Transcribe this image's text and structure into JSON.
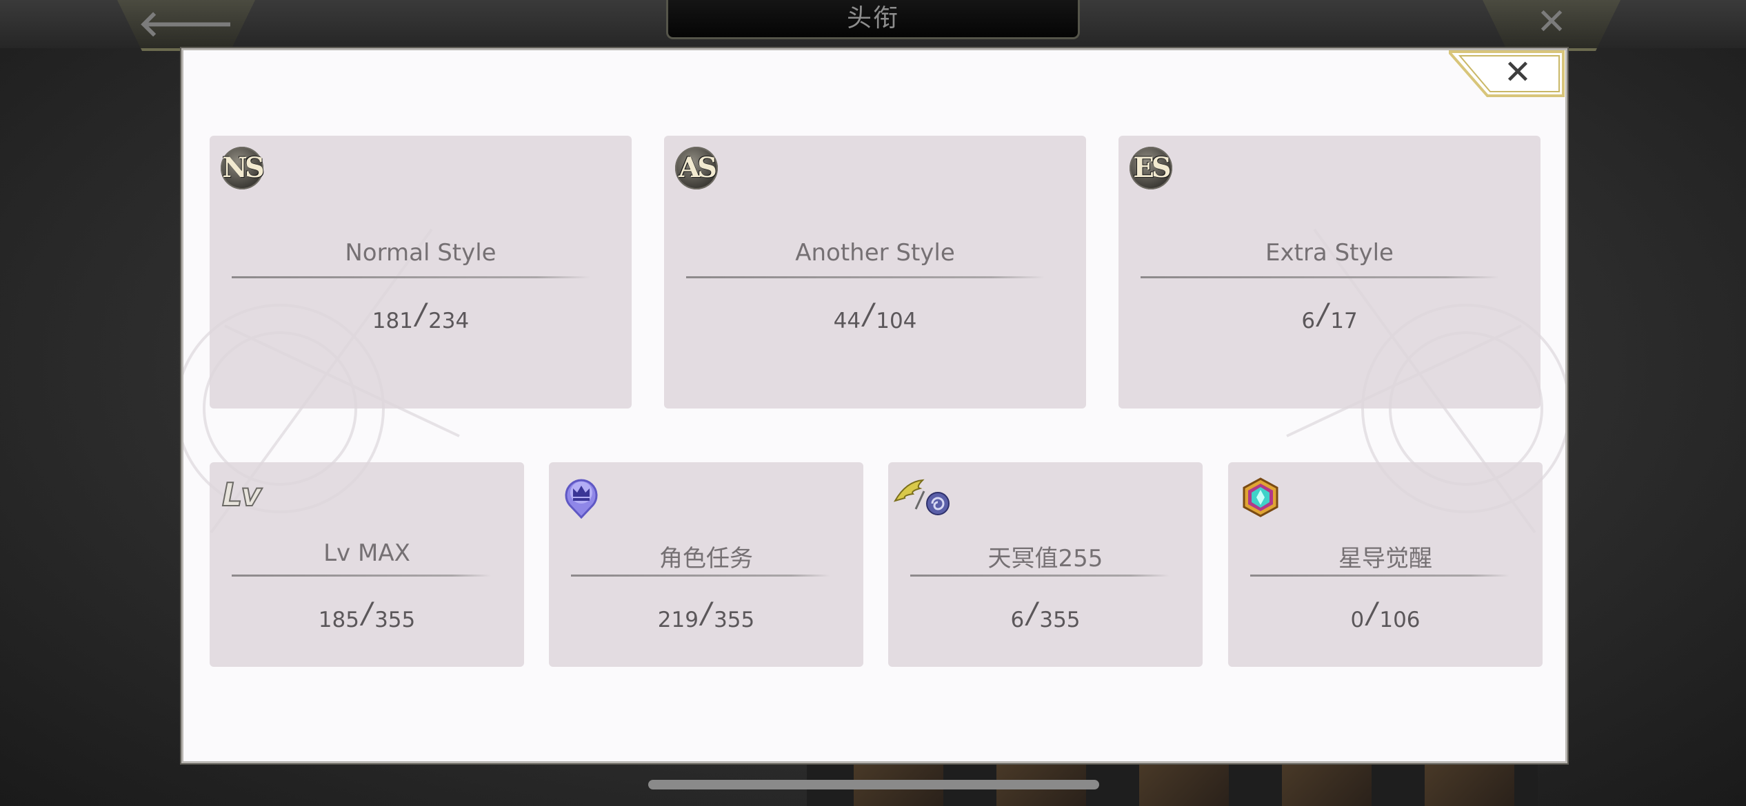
{
  "screen": {
    "title": "头衔",
    "back_glyph": "🡐",
    "close_glyph": "✕"
  },
  "modal": {
    "close_glyph": "✕"
  },
  "style_cards": [
    {
      "badge": "NS",
      "label": "Normal Style",
      "current": "181",
      "total": "234"
    },
    {
      "badge": "AS",
      "label": "Another Style",
      "current": "44",
      "total": "104"
    },
    {
      "badge": "ES",
      "label": "Extra Style",
      "current": "6",
      "total": "17"
    }
  ],
  "stat_cards": [
    {
      "badge": "Lv",
      "icon": "lv-icon",
      "label": "Lv MAX",
      "current": "185",
      "total": "355"
    },
    {
      "icon": "crown-pin-icon",
      "label": "角色任务",
      "current": "219",
      "total": "355"
    },
    {
      "icon": "wing-swirl-icon",
      "label": "天冥值255",
      "current": "6",
      "total": "355"
    },
    {
      "icon": "hexagon-gem-icon",
      "label": "星导觉醒",
      "current": "0",
      "total": "106"
    }
  ],
  "colors": {
    "modal_bg": "#fbfafc",
    "card_bg": "#ddd6db",
    "label_text": "#757073",
    "count_text": "#5b575a",
    "gold_trim": "#d8c57a"
  }
}
